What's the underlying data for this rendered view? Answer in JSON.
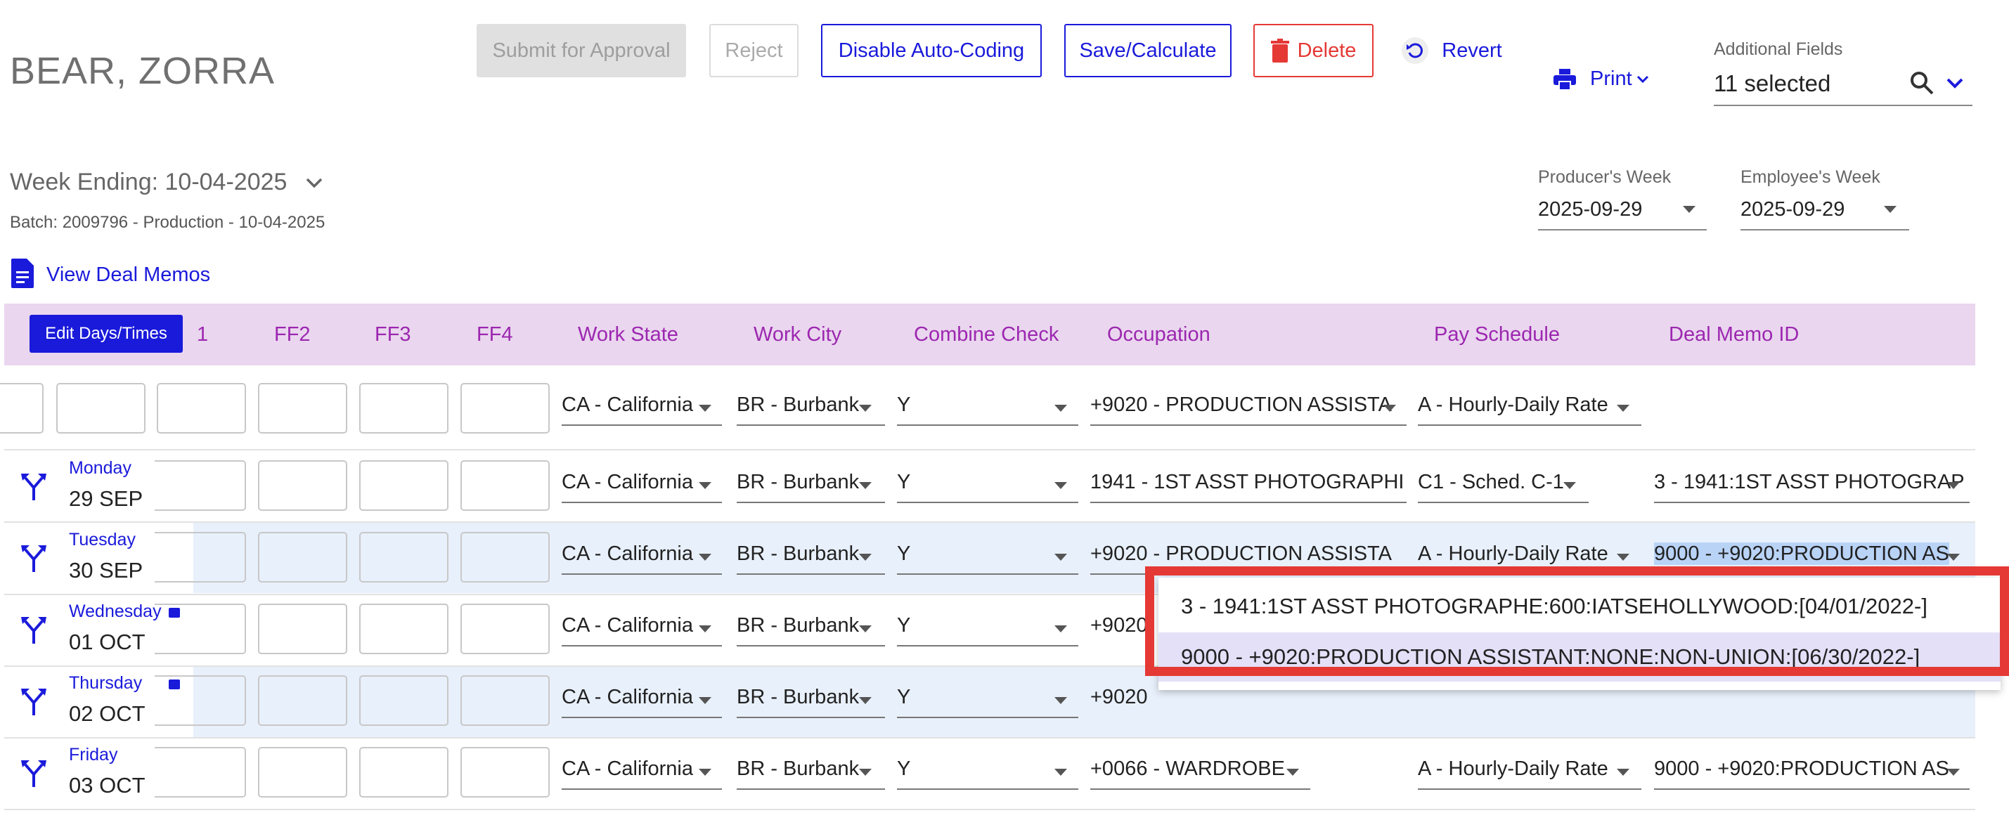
{
  "employee_name": "BEAR, ZORRA",
  "toolbar": {
    "submit": "Submit for Approval",
    "reject": "Reject",
    "disable_auto_coding": "Disable Auto-Coding",
    "save_calculate": "Save/Calculate",
    "delete": "Delete",
    "revert": "Revert",
    "print": "Print"
  },
  "additional_fields": {
    "label": "Additional Fields",
    "value": "11 selected"
  },
  "week_ending": "Week Ending: 10-04-2025",
  "batch": "Batch: 2009796 - Production - 10-04-2025",
  "producers_week": {
    "label": "Producer's Week",
    "value": "2025-09-29"
  },
  "employees_week": {
    "label": "Employee's Week",
    "value": "2025-09-29"
  },
  "view_deal_memos": "View Deal Memos",
  "table": {
    "edit_button": "Edit Days/Times",
    "headers": [
      "1",
      "FF2",
      "FF3",
      "FF4",
      "Work State",
      "Work City",
      "Combine Check",
      "Occupation",
      "Pay Schedule",
      "Deal Memo ID"
    ],
    "default_row": {
      "work_state": "CA - California",
      "work_city": "BR - Burbank",
      "combine_check": "Y",
      "occupation": "+9020 - PRODUCTION ASSISTA",
      "pay_schedule": "A - Hourly-Daily Rate",
      "deal_memo": ""
    },
    "rows": [
      {
        "day": "Monday",
        "date": "29 SEP",
        "work_state": "CA - California",
        "work_city": "BR - Burbank",
        "combine_check": "Y",
        "occupation": "1941 - 1ST ASST PHOTOGRAPHI",
        "pay_schedule": "C1 - Sched. C-1",
        "deal_memo": "3 - 1941:1ST ASST PHOTOGRAP"
      },
      {
        "day": "Tuesday",
        "date": "30 SEP",
        "work_state": "CA - California",
        "work_city": "BR - Burbank",
        "combine_check": "Y",
        "occupation": "+9020 - PRODUCTION ASSISTA",
        "pay_schedule": "A - Hourly-Daily Rate",
        "deal_memo": "9000 - +9020:PRODUCTION AS"
      },
      {
        "day": "Wednesday",
        "date": "01 OCT",
        "work_state": "CA - California",
        "work_city": "BR - Burbank",
        "combine_check": "Y",
        "occupation": "+9020",
        "pay_schedule": "",
        "deal_memo": ""
      },
      {
        "day": "Thursday",
        "date": "02 OCT",
        "work_state": "CA - California",
        "work_city": "BR - Burbank",
        "combine_check": "Y",
        "occupation": "+9020",
        "pay_schedule": "",
        "deal_memo": ""
      },
      {
        "day": "Friday",
        "date": "03 OCT",
        "work_state": "CA - California",
        "work_city": "BR - Burbank",
        "combine_check": "Y",
        "occupation": "+0066 - WARDROBE",
        "pay_schedule": "A - Hourly-Daily Rate",
        "deal_memo": "9000 - +9020:PRODUCTION AS"
      }
    ]
  },
  "deal_memo_dropdown": {
    "options": [
      "3 - 1941:1ST ASST PHOTOGRAPHE:600:IATSEHOLLYWOOD:[04/01/2022-]",
      "9000 - +9020:PRODUCTION ASSISTANT:NONE:NON-UNION:[06/30/2022-]"
    ],
    "selected_index": 1
  },
  "colors": {
    "accent": "#1a1adb",
    "header_bg": "#ead6ef",
    "header_text": "#9c27b0",
    "delete": "#e53935",
    "highlight_row": "#e8f0fb"
  }
}
